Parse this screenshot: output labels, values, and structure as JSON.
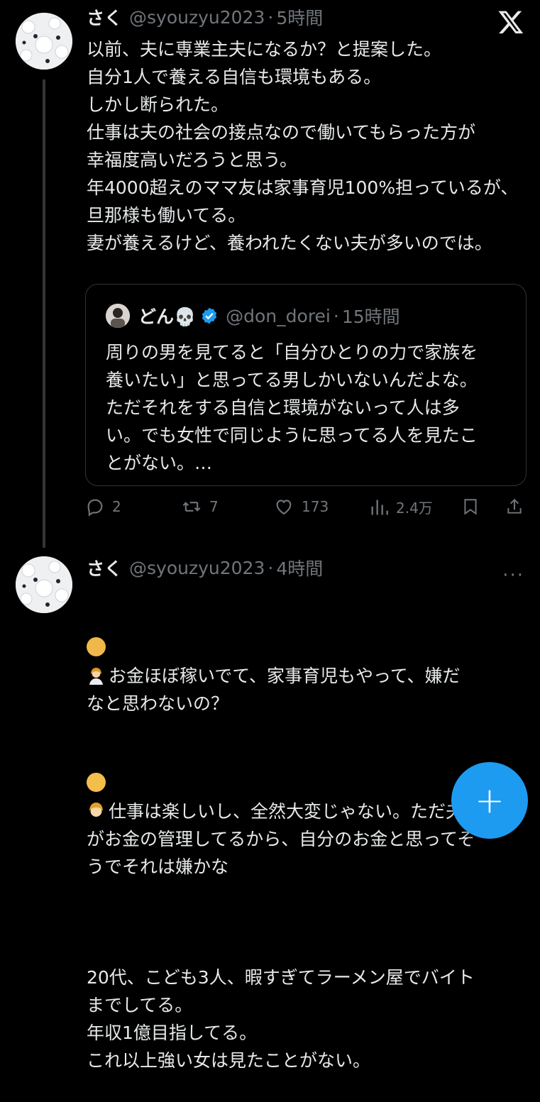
{
  "tweets": [
    {
      "name": "さく",
      "handle": "@syouzyu2023",
      "dot": "·",
      "time": "5時間",
      "text": "以前、夫に専業主夫になるか？と提案した。\n自分1人で養える自信も環境もある。\nしかし断られた。\n仕事は夫の社会の接点なので働いてもらった方が\n幸福度高いだろうと思う。\n年4000超えのママ友は家事育児100%担っているが、旦那様も働いてる。\n妻が養えるけど、養われたくない夫が多いのでは。",
      "quote": {
        "name": "どん💀",
        "handle": "@don_dorei",
        "dot": "·",
        "time": "15時間",
        "text": "周りの男を見てると「自分ひとりの力で家族を\n養いたい」と思ってる男しかいないんだよな。\nただそれをする自信と環境がないって人は多\nい。でも女性で同じように思ってる人を見たこ\nとがない。…"
      },
      "actions": {
        "replies": "2",
        "retweets": "7",
        "likes": "173",
        "views": "2.4万"
      }
    },
    {
      "name": "さく",
      "handle": "@syouzyu2023",
      "dot": "·",
      "time": "4時間",
      "more": "···",
      "line1": "お金ほぼ稼いでて、家事育児もやって、嫌だ\nなと思わないの？",
      "line2": "仕事は楽しいし、全然大変じゃない。ただ夫\nがお金の管理してるから、自分のお金と思ってそ\nうでそれは嫌かな",
      "line3": "20代、こども3人、暇すぎてラーメン屋でバイト\nまでしてる。\n年収1億目指してる。\nこれ以上強い女は見たことがない。"
    }
  ],
  "fab_label": "+"
}
